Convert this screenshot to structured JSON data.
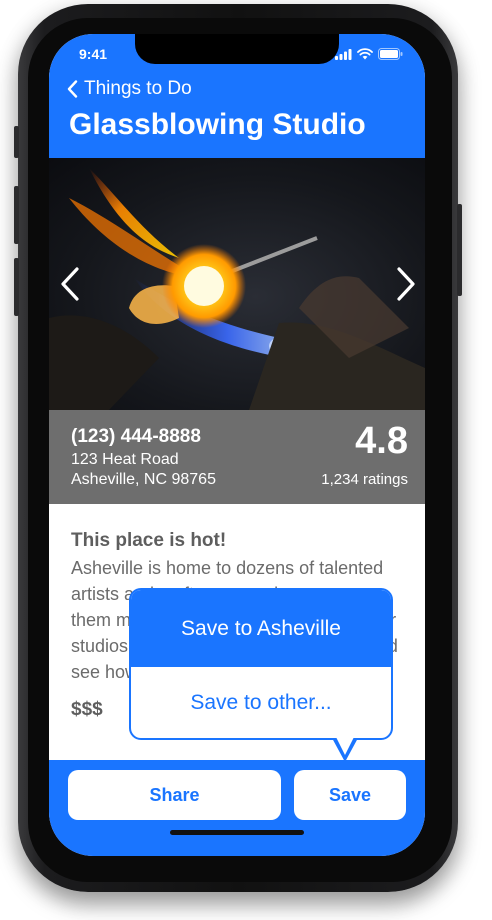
{
  "status": {
    "time": "9:41"
  },
  "nav": {
    "back_label": "Things to Do",
    "title": "Glassblowing Studio"
  },
  "place": {
    "phone": "(123) 444-8888",
    "address_line1": "123 Heat Road",
    "address_line2": "Asheville, NC 98765",
    "rating": "4.8",
    "ratings_count": "1,234 ratings"
  },
  "description": {
    "heading": "This place is hot!",
    "body": "Asheville is home to dozens of talented artists and craftsmen, and you can see them making all kinds of glass art in their studios and workshops. Take a class and see how hot shops really work.",
    "price": "$$$"
  },
  "actions": {
    "share_label": "Share",
    "save_label": "Save"
  },
  "save_menu": {
    "primary": "Save to Asheville",
    "secondary": "Save to other..."
  },
  "colors": {
    "accent": "#1a75ff",
    "info_bar": "#6e6e6e"
  }
}
